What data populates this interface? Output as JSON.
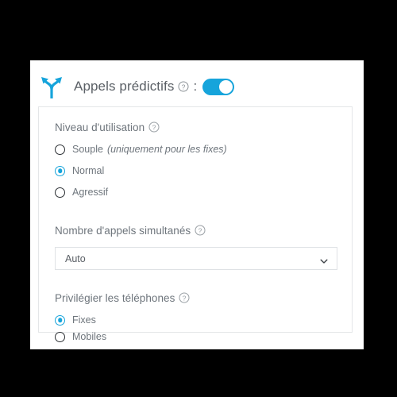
{
  "background_color": "#000000",
  "accent_color": "#16a4db",
  "text_color": "#6e757c",
  "header": {
    "icon": "fork-arrows-icon",
    "title": "Appels prédictifs",
    "help_icon": "help-circle-icon",
    "separator": ":",
    "toggle": {
      "name": "predictive-calls-toggle",
      "state": "on",
      "on_color": "#16a4db"
    }
  },
  "panel": {
    "fields": [
      {
        "label": "Niveau d'utilisation",
        "help_icon": "help-circle-icon",
        "type": "radio-group",
        "options": [
          {
            "label": "Souple",
            "note": "(uniquement pour les fixes)",
            "selected": false
          },
          {
            "label": "Normal",
            "note": "",
            "selected": true
          },
          {
            "label": "Agressif",
            "note": "",
            "selected": false
          }
        ]
      },
      {
        "label": "Nombre d'appels simultanés",
        "help_icon": "help-circle-icon",
        "type": "select",
        "value": "Auto",
        "chevron_icon": "chevron-down-icon"
      },
      {
        "label": "Privilégier les téléphones",
        "help_icon": "help-circle-icon",
        "type": "radio-group",
        "options": [
          {
            "label": "Fixes",
            "note": "",
            "selected": true
          },
          {
            "label": "Mobiles",
            "note": "",
            "selected": false
          }
        ]
      }
    ]
  }
}
